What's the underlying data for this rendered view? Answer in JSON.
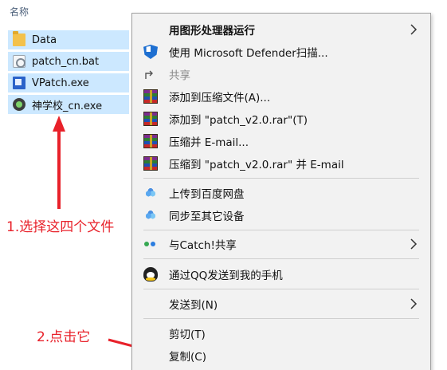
{
  "explorer": {
    "column_header": "名称",
    "files": [
      {
        "name": "Data",
        "icon": "folder-icon"
      },
      {
        "name": "patch_cn.bat",
        "icon": "batch-file-icon"
      },
      {
        "name": "VPatch.exe",
        "icon": "exe-icon"
      },
      {
        "name": "神学校_cn.exe",
        "icon": "game-exe-icon"
      }
    ]
  },
  "annotations": {
    "step1": "1.选择这四个文件",
    "step2": "2.点击它",
    "color": "#e8212a"
  },
  "context_menu": {
    "items": [
      {
        "label": "用图形处理器运行",
        "icon": "",
        "submenu": true,
        "bold": true
      },
      {
        "label": "使用 Microsoft Defender扫描...",
        "icon": "defender-shield-icon"
      },
      {
        "label": "共享",
        "icon": "share-icon",
        "disabled": true
      },
      {
        "label": "添加到压缩文件(A)...",
        "icon": "winrar-icon"
      },
      {
        "label": "添加到 \"patch_v2.0.rar\"(T)",
        "icon": "winrar-icon"
      },
      {
        "label": "压缩并 E-mail...",
        "icon": "winrar-icon"
      },
      {
        "label": "压缩到 \"patch_v2.0.rar\" 并 E-mail",
        "icon": "winrar-icon"
      },
      {
        "label": "上传到百度网盘",
        "icon": "baidu-cloud-icon"
      },
      {
        "label": "同步至其它设备",
        "icon": "baidu-cloud-icon"
      },
      {
        "label": "与Catch!共享",
        "icon": "catch-icon",
        "submenu": true
      },
      {
        "label": "通过QQ发送到我的手机",
        "icon": "qq-icon"
      },
      {
        "label": "发送到(N)",
        "icon": "",
        "submenu": true
      },
      {
        "label": "剪切(T)",
        "icon": ""
      },
      {
        "label": "复制(C)",
        "icon": ""
      }
    ]
  }
}
